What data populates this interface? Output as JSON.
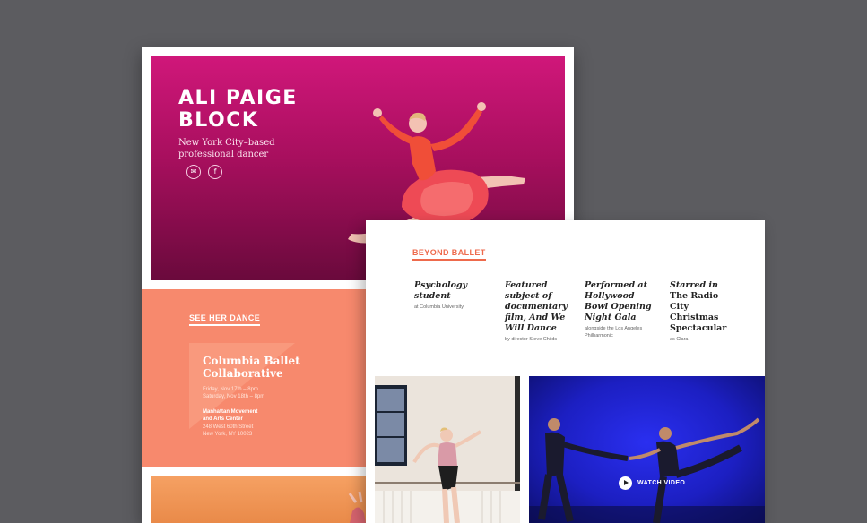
{
  "hero": {
    "name": "ALI PAIGE\nBLOCK",
    "tagline": "New York City–based professional dancer",
    "icons": [
      "mail-icon",
      "facebook-icon"
    ]
  },
  "performances": {
    "heading": "SEE HER DANCE",
    "event": {
      "title": "Columbia Ballet Collaborative",
      "dates": "Friday, Nov 17th – 8pm\nSaturday, Nov 18th – 8pm",
      "venue": "Manhattan Movement\nand Arts Center",
      "address": "248 West 60th Street\nNew York, NY 10023"
    }
  },
  "beyond": {
    "heading": "BEYOND BALLET",
    "credits": [
      {
        "title": "Psychology student",
        "subtitle": "at Columbia University"
      },
      {
        "title": "Featured subject of documentary film, And We Will Dance",
        "subtitle": "by director Steve Childs"
      },
      {
        "title": "Performed at Hollywood Bowl Opening Night Gala",
        "subtitle": "alongside the Los Angeles Philharmonic"
      },
      {
        "title_italic": "Starred in",
        "title_rest": " The Radio City Christmas Spectacular",
        "subtitle": "as Clara"
      }
    ]
  },
  "video": {
    "label": "WATCH VIDEO"
  },
  "colors": {
    "hero": "#c0146e",
    "coral": "#f7896d",
    "accent": "#ee6a4c",
    "stage": "#1c1fc2"
  }
}
